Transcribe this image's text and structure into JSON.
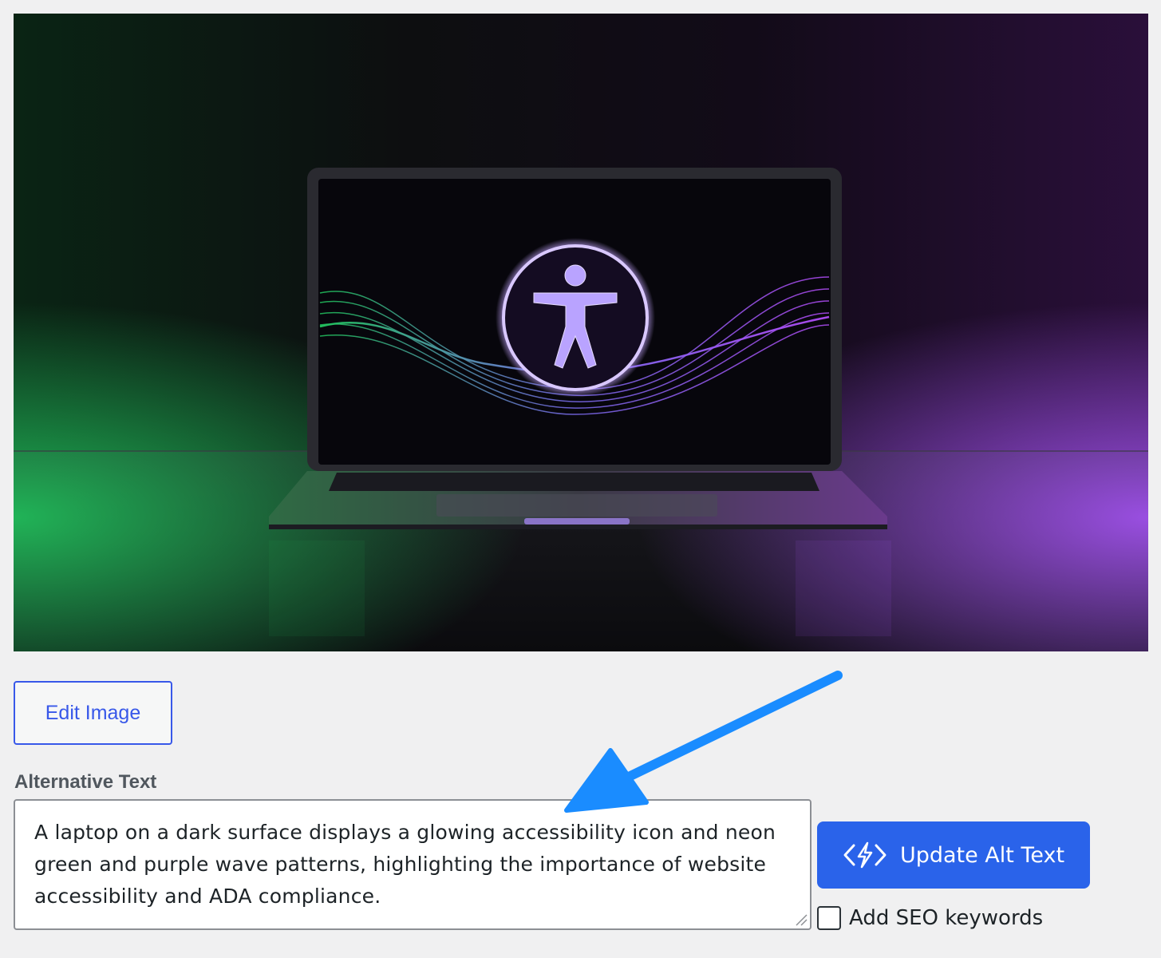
{
  "preview": {
    "alt": "Laptop displaying a glowing accessibility icon with neon green and purple waves",
    "colors": {
      "left_glow": "#22c55e",
      "right_glow": "#a855f7",
      "background": "#0c0c12"
    }
  },
  "edit_button": {
    "label": "Edit Image"
  },
  "alt_text": {
    "label": "Alternative Text",
    "value": "A laptop on a dark surface displays a glowing accessibility icon and neon green and purple wave patterns, highlighting the importance of website accessibility and ADA compliance."
  },
  "update_button": {
    "label": "Update Alt Text",
    "icon": "ai-code-bolt-icon",
    "color": "#2a63ea"
  },
  "seo": {
    "label": "Add SEO keywords",
    "checked": false
  },
  "annotation": {
    "icon": "pointer-arrow",
    "color": "#1a8cff"
  }
}
